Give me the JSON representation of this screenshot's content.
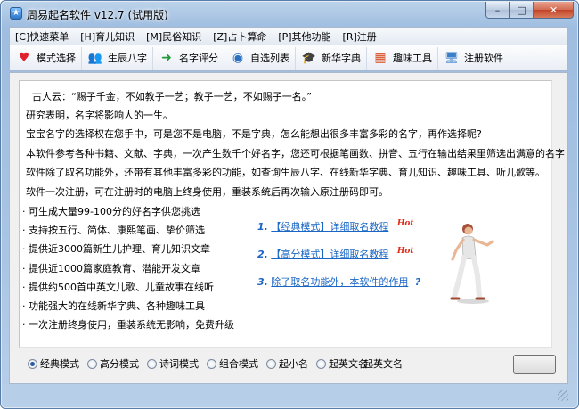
{
  "window": {
    "title": "周易起名软件 v12.7 (试用版)",
    "accent": "#a9c4e4"
  },
  "caption_buttons": {
    "minimize": "–",
    "maximize": "□",
    "close": "✕"
  },
  "menu": [
    {
      "label": "[C]快速菜单"
    },
    {
      "label": "[H]育儿知识"
    },
    {
      "label": "[M]民俗知识"
    },
    {
      "label": "[Z]占卜算命"
    },
    {
      "label": "[P]其他功能"
    },
    {
      "label": "[R]注册"
    }
  ],
  "toolbar": [
    {
      "label": "模式选择",
      "icon": "heart-icon",
      "glyph": "♥",
      "color": "#e0222f"
    },
    {
      "label": "生辰八字",
      "icon": "people-icon",
      "glyph": "👥",
      "color": "#3a6fb5"
    },
    {
      "label": "名字评分",
      "icon": "arrow-circle-icon",
      "glyph": "➜",
      "color": "#1e9a3a"
    },
    {
      "label": "自选列表",
      "icon": "globe-icon",
      "glyph": "◉",
      "color": "#2a6fc0"
    },
    {
      "label": "新华字典",
      "icon": "scholar-icon",
      "glyph": "🎓",
      "color": "#333333"
    },
    {
      "label": "趣味工具",
      "icon": "windows-icon",
      "glyph": "▦",
      "color": "#d84a1c"
    },
    {
      "label": "注册软件",
      "icon": "monitor-icon",
      "glyph": "🖥",
      "color": "#3a7fc8"
    }
  ],
  "intro": [
    "古人云：“赐子千金，不如教子一艺；教子一艺，不如赐子一名。”",
    "研究表明，名字将影响人的一生。",
    "宝宝名字的选择权在您手中，可是您不是电脑，不是字典，怎么能想出很多丰富多彩的名字，再作选择呢?",
    "本软件参考各种书籍、文献、字典，一次产生数千个好名字，您还可根据笔画数、拼音、五行在输出结果里筛选出满意的名字",
    "软件除了取名功能外，还带有其他丰富多彩的功能，如查询生辰八字、在线新华字典、育儿知识、趣味工具、听儿歌等。",
    "软件一次注册，可在注册时的电脑上终身使用，重装系统后再次输入原注册码即可。"
  ],
  "features": [
    "·  可生成大量99-100分的好名字供您挑选",
    "·  支持按五行、简体、康熙笔画、挚价筛选",
    "·  提供近3000篇新生儿护理、育儿知识文章",
    "·  提供近1000篇家庭教育、潜能开发文章",
    "·  提供约500首中英文儿歌、儿童故事在线听",
    "·  功能强大的在线新华字典、各种趣味工具",
    "·  一次注册终身使用，重装系统无影响，免费升级"
  ],
  "guides": [
    {
      "num": "1.",
      "text": "【经典模式】详细取名教程",
      "badge": "Hot"
    },
    {
      "num": "2.",
      "text": "【高分模式】详细取名教程",
      "badge": "Hot"
    },
    {
      "num": "3.",
      "text": "除了取名功能外，本软件的作用",
      "badge": "?"
    }
  ],
  "modes": [
    {
      "label": "经典模式",
      "selected": true
    },
    {
      "label": "高分模式",
      "selected": false
    },
    {
      "label": "诗词模式",
      "selected": false
    },
    {
      "label": "组合模式",
      "selected": false
    },
    {
      "label": "起小名",
      "selected": false
    },
    {
      "label": "起英文名",
      "selected": false
    },
    {
      "label": "起英文名",
      "selected": false
    }
  ]
}
